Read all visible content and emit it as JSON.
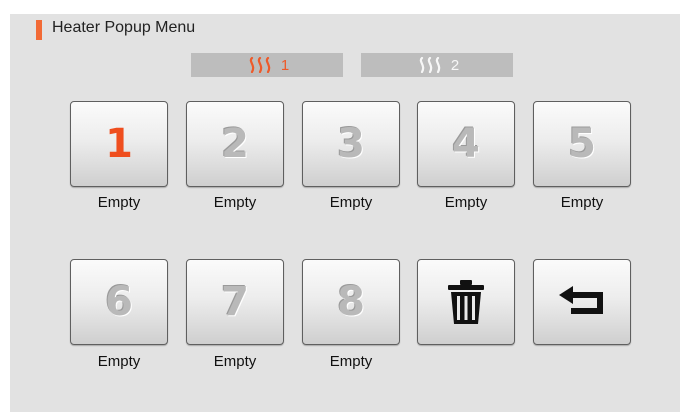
{
  "title": "Heater Popup Menu",
  "colors": {
    "accent": "#f26a36",
    "panel": "#e2e2e2",
    "tab": "#bdbdbd"
  },
  "heater_tabs": [
    {
      "label": "1",
      "icon": "heat-waves-icon",
      "active": true
    },
    {
      "label": "2",
      "icon": "heat-waves-icon",
      "active": false
    }
  ],
  "slots": [
    {
      "number": "1",
      "label": "Empty",
      "selected": true
    },
    {
      "number": "2",
      "label": "Empty"
    },
    {
      "number": "3",
      "label": "Empty"
    },
    {
      "number": "4",
      "label": "Empty"
    },
    {
      "number": "5",
      "label": "Empty"
    },
    {
      "number": "6",
      "label": "Empty"
    },
    {
      "number": "7",
      "label": "Empty"
    },
    {
      "number": "8",
      "label": "Empty"
    }
  ],
  "actions": {
    "delete_icon": "trash-icon",
    "back_icon": "return-arrow-icon"
  }
}
